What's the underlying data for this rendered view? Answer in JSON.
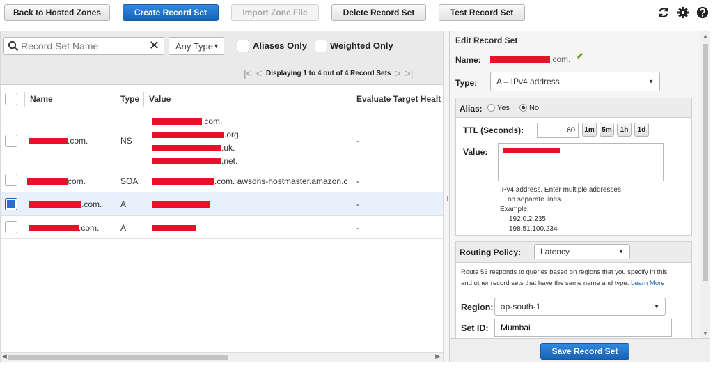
{
  "toolbar": {
    "back": "Back to Hosted Zones",
    "create": "Create Record Set",
    "import": "Import Zone File",
    "delete": "Delete Record Set",
    "test": "Test Record Set",
    "icons": [
      "refresh-icon",
      "gear-icon",
      "help-icon"
    ]
  },
  "filters": {
    "search_placeholder": "Record Set Name",
    "type_value": "Any Type",
    "aliases_only": "Aliases Only",
    "weighted_only": "Weighted Only",
    "pager_text": "Displaying 1 to 4 out of 4 Record Sets"
  },
  "table": {
    "columns": [
      "Name",
      "Type",
      "Value",
      "Evaluate Target Healt"
    ],
    "rows": [
      {
        "name_suffix": ".com.",
        "type": "NS",
        "values": [
          ".com.",
          ".org.",
          ".uk.",
          ".net."
        ],
        "evaluate": "-",
        "selected": false
      },
      {
        "name_suffix": "com.",
        "type": "SOA",
        "values": [
          ".com. awsdns-hostmaster.amazon.c"
        ],
        "evaluate": "-",
        "selected": false
      },
      {
        "name_suffix": ".com.",
        "type": "A",
        "values": [
          ""
        ],
        "evaluate": "-",
        "selected": true
      },
      {
        "name_suffix": ".com.",
        "type": "A",
        "values": [
          ""
        ],
        "evaluate": "-",
        "selected": false
      }
    ]
  },
  "edit": {
    "title": "Edit Record Set",
    "name_label": "Name:",
    "name_suffix": ".com.",
    "type_label": "Type:",
    "type_value": "A – IPv4 address",
    "alias_label": "Alias:",
    "alias_yes": "Yes",
    "alias_no": "No",
    "ttl_label": "TTL (Seconds):",
    "ttl_value": "60",
    "ttl_buttons": [
      "1m",
      "5m",
      "1h",
      "1d"
    ],
    "value_label": "Value:",
    "value_help": [
      "IPv4 address. Enter multiple addresses",
      "on separate lines.",
      "Example:",
      "192.0.2.235",
      "198.51.100.234"
    ],
    "routing_label": "Routing Policy:",
    "routing_value": "Latency",
    "routing_desc_1": "Route 53 responds to queries based on regions that you specify in this",
    "routing_desc_2": "and other record sets that have the same name and type.",
    "learn_more": "Learn More",
    "region_label": "Region:",
    "region_value": "ap-south-1",
    "setid_label": "Set ID:",
    "setid_value": "Mumbai",
    "save": "Save Record Set"
  },
  "colors": {
    "primary": "#1a63b5",
    "redaction": "#e8112a",
    "selected_row": "#e8f0fb"
  }
}
